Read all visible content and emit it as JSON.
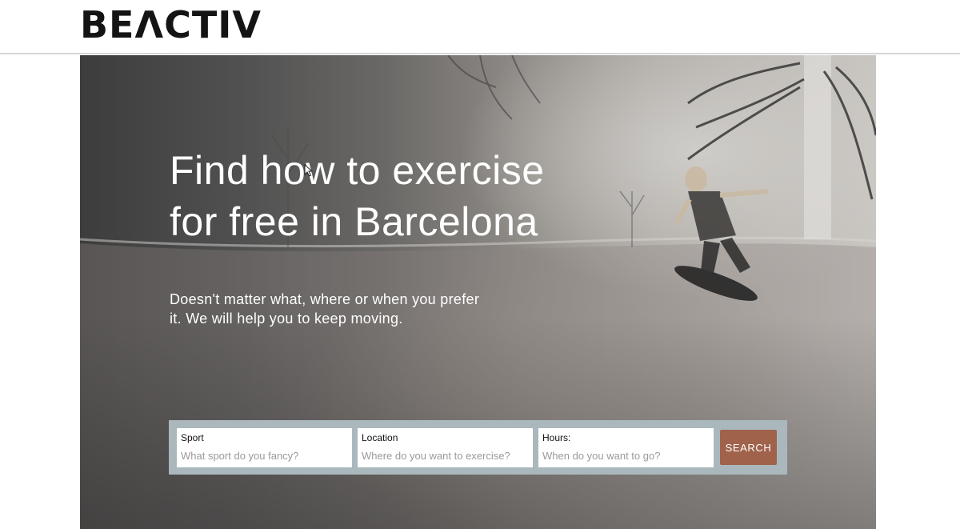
{
  "brand": {
    "logo_text": "BEΛCTIV"
  },
  "hero": {
    "title": "Find how to exercise for free in Barcelona",
    "subtitle": "Doesn't matter what, where or when you prefer it. We will help you to keep moving."
  },
  "search": {
    "sport": {
      "label": "Sport",
      "placeholder": "What sport do you fancy?",
      "value": ""
    },
    "location": {
      "label": "Location",
      "placeholder": "Where do you want to exercise?",
      "value": ""
    },
    "hours": {
      "label": "Hours:",
      "placeholder": "When do you want to go?",
      "value": ""
    },
    "button_label": "SEARCH"
  },
  "colors": {
    "search_button": "#a0624b",
    "search_bar_bg": "#aab8bd",
    "logo": "#141414"
  },
  "icons": {
    "cursor": "mouse-pointer-icon"
  }
}
